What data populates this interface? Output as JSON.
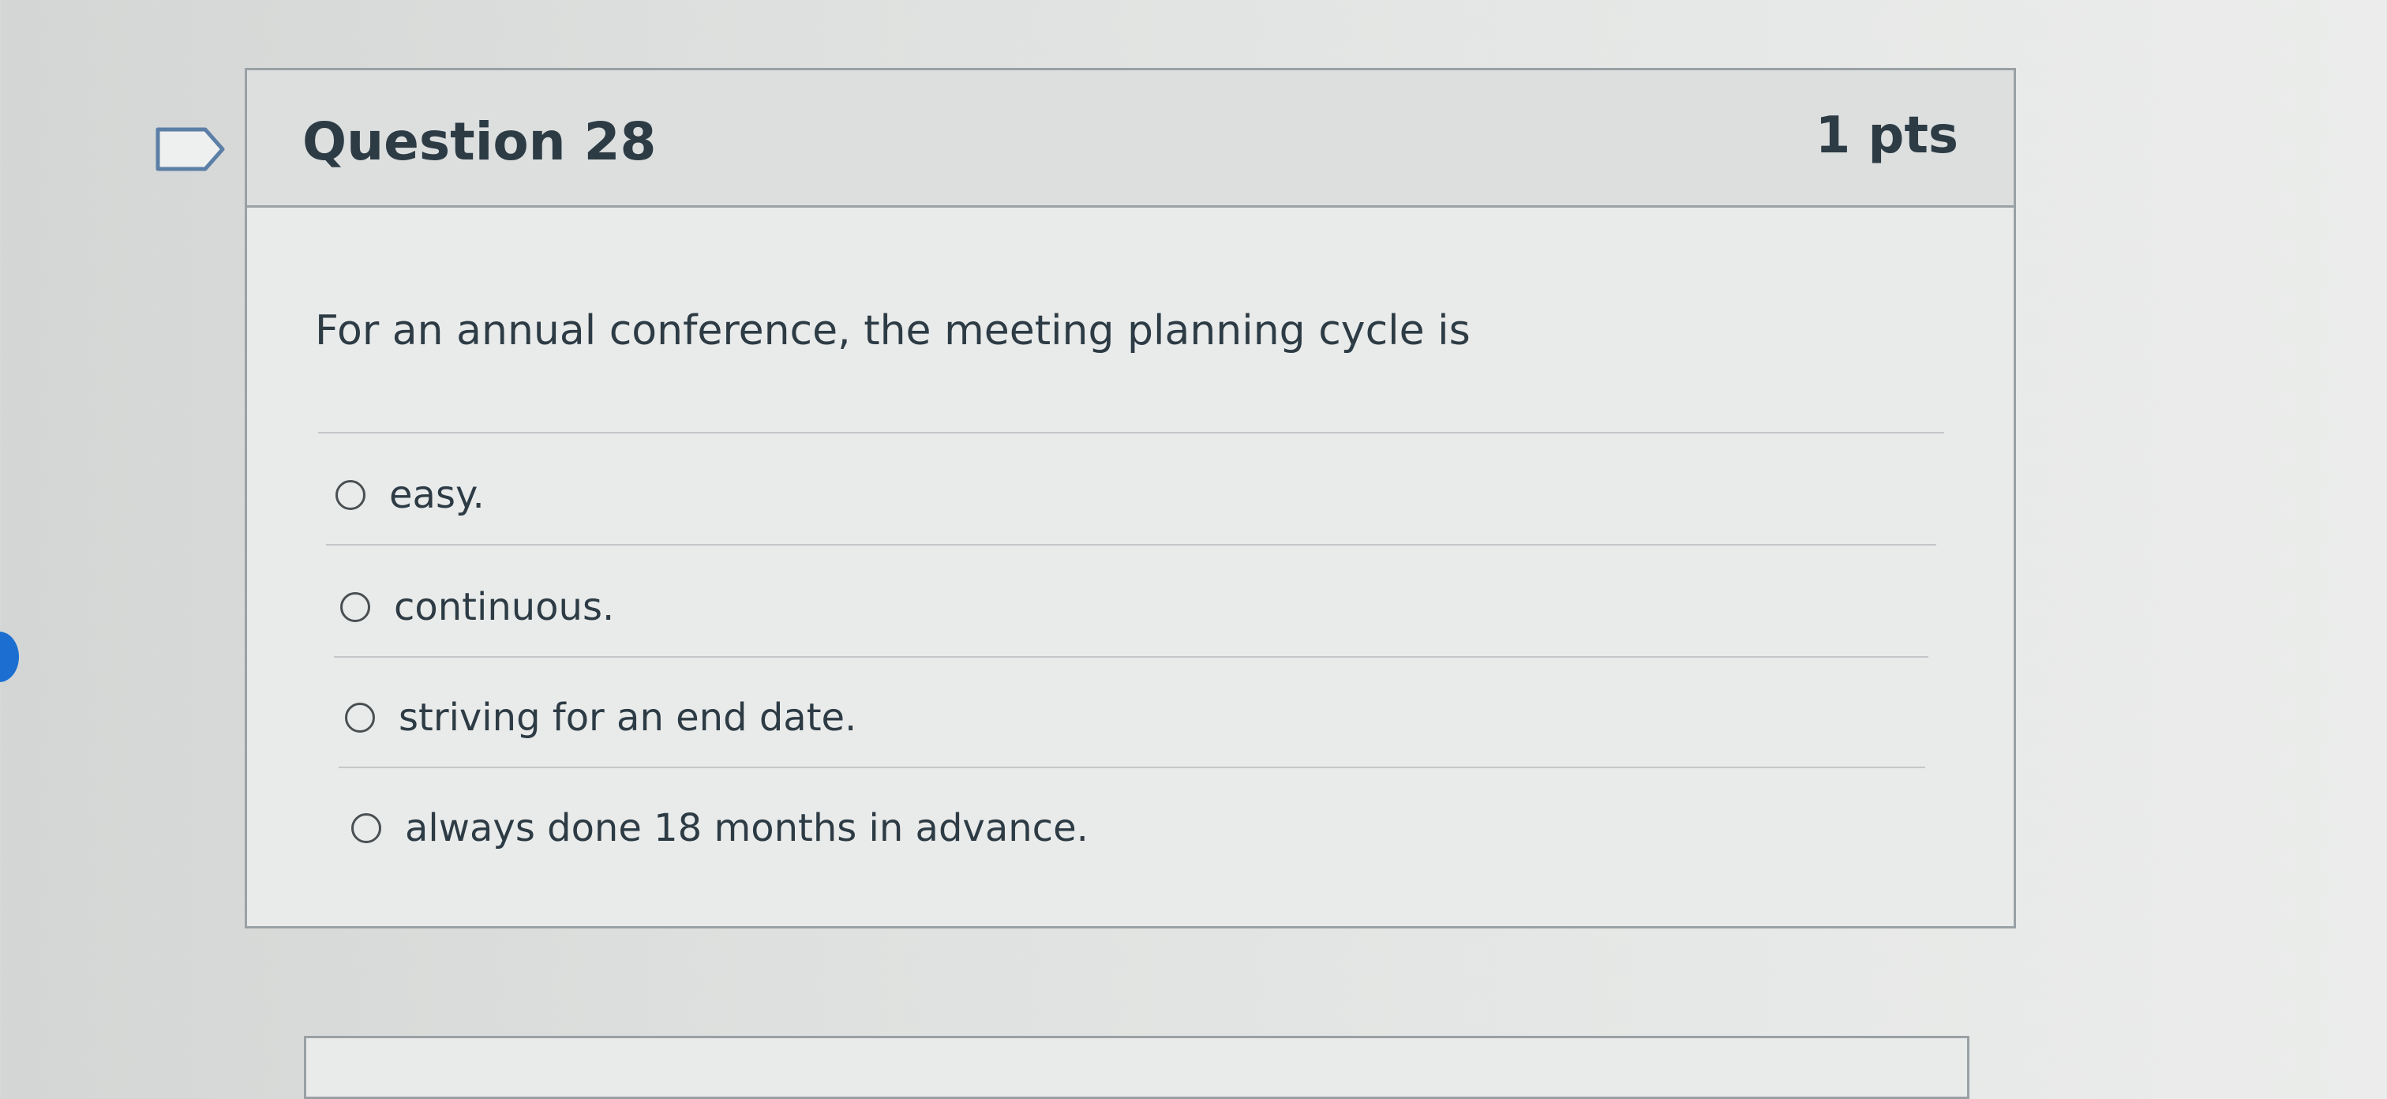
{
  "question": {
    "title": "Question 28",
    "points": "1 pts",
    "text": "For an annual conference, the meeting planning cycle is",
    "flag_icon": "flag-outline-icon",
    "answers": [
      {
        "label": "easy."
      },
      {
        "label": "continuous."
      },
      {
        "label": "striving for an end date."
      },
      {
        "label": "always done 18 months in advance."
      }
    ]
  },
  "colors": {
    "text": "#2d3b45",
    "border": "#9aa1a5",
    "header_bg": "#dcdfde",
    "card_bg": "#e9ebea",
    "accent_blue": "#1c6fd1"
  }
}
